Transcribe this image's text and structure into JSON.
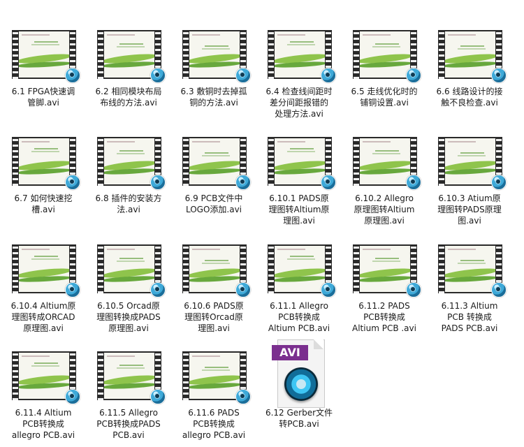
{
  "files": [
    {
      "name": "6.1 FPGA快速调\n管脚.avi",
      "type": "film"
    },
    {
      "name": "6.2 相同模块布局\n布线的方法.avi",
      "type": "film"
    },
    {
      "name": "6.3 敷铜时去掉孤\n铜的方法.avi",
      "type": "film"
    },
    {
      "name": "6.4 检查线间距时\n差分间距报错的\n处理方法.avi",
      "type": "film"
    },
    {
      "name": "6.5 走线优化时的\n铺铜设置.avi",
      "type": "film"
    },
    {
      "name": "6.6 线路设计的接\n触不良检查.avi",
      "type": "film"
    },
    {
      "name": "6.7 如何快速挖\n槽.avi",
      "type": "film"
    },
    {
      "name": "6.8 插件的安装方\n法.avi",
      "type": "film"
    },
    {
      "name": "6.9 PCB文件中\nLOGO添加.avi",
      "type": "film"
    },
    {
      "name": "6.10.1  PADS原\n理图转Altium原\n理图.avi",
      "type": "film"
    },
    {
      "name": "6.10.2  Allegro\n原理图转Altium\n原理图.avi",
      "type": "film"
    },
    {
      "name": "6.10.3  Atium原\n理图转PADS原理\n图.avi",
      "type": "film"
    },
    {
      "name": "6.10.4  Altium原\n理图转成ORCAD\n原理图.avi",
      "type": "film"
    },
    {
      "name": "6.10.5  Orcad原\n理图转换成PADS\n原理图.avi",
      "type": "film"
    },
    {
      "name": "6.10.6  PADS原\n理图转Orcad原\n理图.avi",
      "type": "film"
    },
    {
      "name": "6.11.1 Allegro\nPCB转换成\nAltium PCB.avi",
      "type": "film"
    },
    {
      "name": "6.11.2 PADS\nPCB转换成\nAltium PCB .avi",
      "type": "film"
    },
    {
      "name": "6.11.3 Altium\nPCB 转换成\nPADS PCB.avi",
      "type": "film"
    },
    {
      "name": "6.11.4 Altium\nPCB转换成\nallegro PCB.avi",
      "type": "film"
    },
    {
      "name": "6.11.5  Allegro\nPCB转换成PADS\nPCB.avi",
      "type": "film"
    },
    {
      "name": "6.11.6 PADS\nPCB转换成\nallegro PCB.avi",
      "type": "film"
    },
    {
      "name": "6.12 Gerber文件\n转PCB.avi",
      "type": "doc",
      "badge": "AVI"
    }
  ],
  "colors": {
    "filmstrip": "#2a2a2a",
    "accent_green": "#7dbb2f",
    "avi_badge": "#7b2f8f",
    "player_blue": "#3ea9d8"
  },
  "icons": {
    "film_item": "video-thumbnail-icon",
    "player_overlay": "media-player-icon",
    "doc_item": "avi-file-icon"
  }
}
